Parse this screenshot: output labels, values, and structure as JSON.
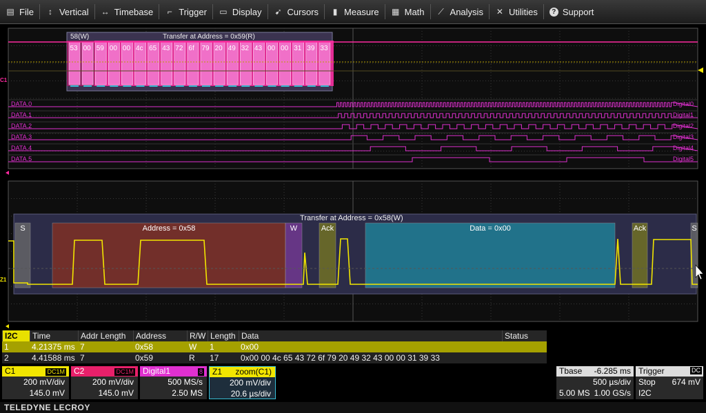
{
  "menu": [
    {
      "label": "File",
      "icon": "file-icon"
    },
    {
      "label": "Vertical",
      "icon": "vertical-arrows-icon"
    },
    {
      "label": "Timebase",
      "icon": "horizontal-arrows-icon"
    },
    {
      "label": "Trigger",
      "icon": "trigger-icon"
    },
    {
      "label": "Display",
      "icon": "display-icon"
    },
    {
      "label": "Cursors",
      "icon": "cursor-icon"
    },
    {
      "label": "Measure",
      "icon": "measure-icon"
    },
    {
      "label": "Math",
      "icon": "math-icon"
    },
    {
      "label": "Analysis",
      "icon": "analysis-icon"
    },
    {
      "label": "Utilities",
      "icon": "wrench-icon"
    },
    {
      "label": "Support",
      "icon": "help-icon"
    }
  ],
  "upper": {
    "channel_marker": "C1",
    "addr_label": "58(W)",
    "transfer_label": "Transfer at Address = 0x59(R)",
    "bytes": [
      "53",
      "00",
      "59",
      "00",
      "00",
      "4c",
      "65",
      "43",
      "72",
      "6f",
      "79",
      "20",
      "49",
      "32",
      "43",
      "00",
      "00",
      "31",
      "39",
      "33"
    ],
    "digital_lines": [
      {
        "name": "DATA.0",
        "tag": "Digital0"
      },
      {
        "name": "DATA.1",
        "tag": "Digital1"
      },
      {
        "name": "DATA.2",
        "tag": "Digital2"
      },
      {
        "name": "DATA.3",
        "tag": "Digital3"
      },
      {
        "name": "DATA.4",
        "tag": "Digital4"
      },
      {
        "name": "DATA.5",
        "tag": "Digital5"
      }
    ]
  },
  "lower": {
    "channel_marker": "Z1",
    "transfer_label": "Transfer at Address = 0x58(W)",
    "segments": [
      {
        "label": "S",
        "kind": "start"
      },
      {
        "label": "Address = 0x58",
        "kind": "address"
      },
      {
        "label": "W",
        "kind": "rw"
      },
      {
        "label": "Ack",
        "kind": "ack"
      },
      {
        "label": "Data = 0x00",
        "kind": "data"
      },
      {
        "label": "Ack",
        "kind": "ack"
      },
      {
        "label": "S",
        "kind": "start"
      }
    ]
  },
  "table": {
    "tag": "I2C",
    "headers": [
      "Time",
      "Addr Length",
      "Address",
      "R/W",
      "Length",
      "Data",
      "Status"
    ],
    "rows": [
      [
        "1",
        "4.21375 ms",
        "7",
        "0x58",
        "W",
        "1",
        "0x00",
        ""
      ],
      [
        "2",
        "4.41588 ms",
        "7",
        "0x59",
        "R",
        "17",
        "0x00 00 4c 65 43 72 6f 79 20 49 32 43 00 00 31 39 33",
        ""
      ]
    ]
  },
  "channels": [
    {
      "name": "C1",
      "badge": "DC1M",
      "v1": "200 mV/div",
      "v2": "145.0 mV",
      "color": "#f2e600",
      "fg": "#000"
    },
    {
      "name": "C2",
      "badge": "DC1M",
      "v1": "200 mV/div",
      "v2": "145.0 mV",
      "color": "#e8206a",
      "fg": "#fff"
    },
    {
      "name": "Digital1",
      "badge": "8",
      "v1": "500 MS/s",
      "v2": "2.50 MS",
      "color": "#e030d0",
      "fg": "#fff"
    },
    {
      "name": "Z1",
      "badge": "zoom(C1)",
      "v1": "200 mV/div",
      "v2": "20.6 µs/div",
      "color": "#f2e600",
      "fg": "#000"
    }
  ],
  "timebase": {
    "label": "Tbase",
    "offset": "-6.285 ms",
    "div": "500 µs/div",
    "samples": "5.00 MS",
    "rate": "1.00 GS/s"
  },
  "trigger": {
    "label": "Trigger",
    "coupling": "DC",
    "mode": "Stop",
    "level": "674 mV",
    "type": "I2C"
  },
  "brand": "TELEDYNE LECROY",
  "colors": {
    "yellow": "#f2e600",
    "pink": "#ff2aa0",
    "magenta": "#e030d0",
    "cyan": "#38c0d8"
  }
}
